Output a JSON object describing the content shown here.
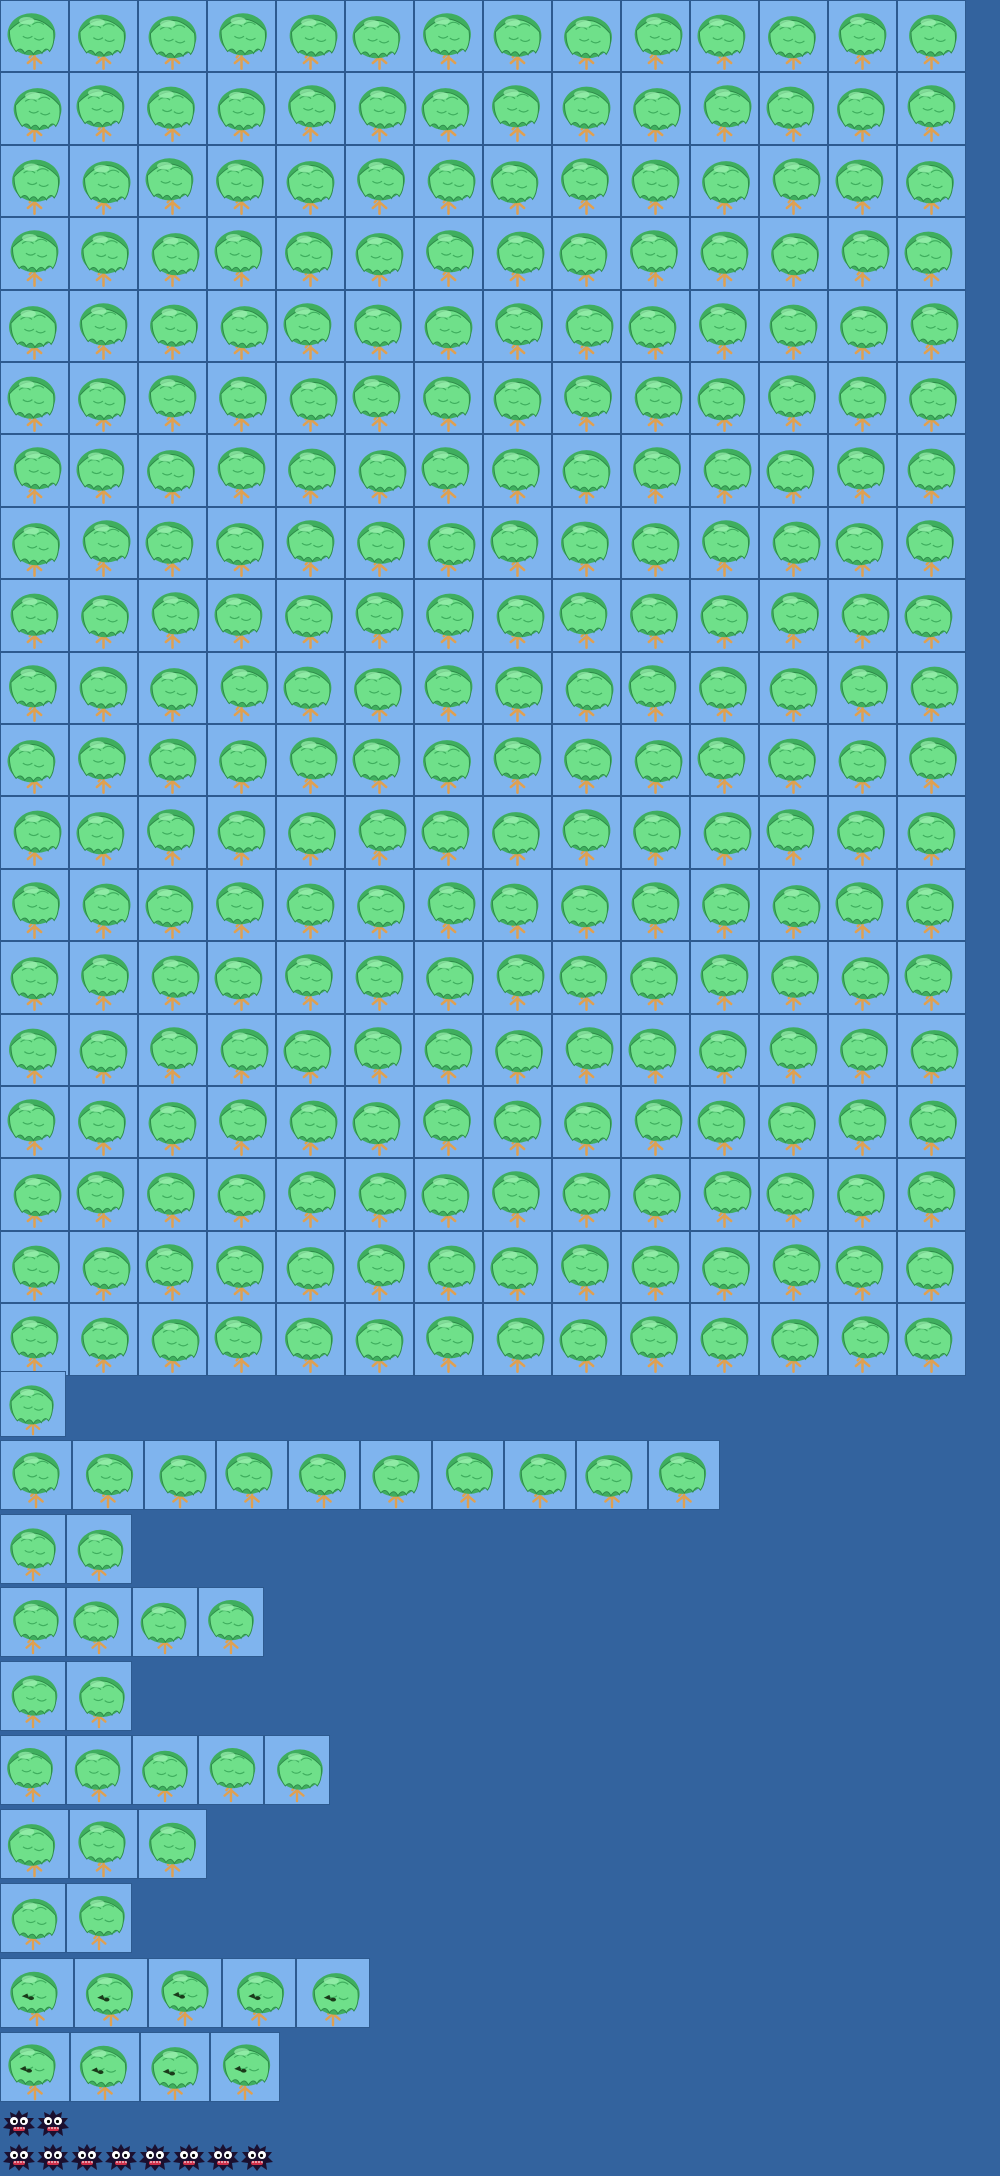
{
  "sheet": {
    "background_color": "#33639e",
    "cell_color": "#7fb4ee",
    "grid_line_color": "#2d5a8f"
  },
  "sprite_types": {
    "tree": {
      "icon": "tree-icon",
      "foliage_color": "#6fe08a",
      "foliage_shadow": "#3fae5e",
      "trunk_color": "#e0a050"
    },
    "tree_with_face": {
      "icon": "tree-face-icon",
      "eye_color": "#1a3a1a"
    },
    "monster": {
      "icon": "spiky-monster-icon",
      "body_color": "#1b1030",
      "eye_color": "#ffffff",
      "mouth_color": "#d0304a"
    }
  },
  "sprite_groups": [
    {
      "name": "tree-grid-main",
      "sprite": "tree",
      "rows": 19,
      "columns": 14
    },
    {
      "name": "tree-strip-1",
      "sprite": "tree",
      "rows": 1,
      "columns": 1
    },
    {
      "name": "tree-strip-2",
      "sprite": "tree",
      "rows": 1,
      "columns": 10
    },
    {
      "name": "tree-strip-3",
      "sprite": "tree",
      "rows": 1,
      "columns": 2
    },
    {
      "name": "tree-strip-4",
      "sprite": "tree",
      "rows": 1,
      "columns": 4
    },
    {
      "name": "tree-strip-5",
      "sprite": "tree",
      "rows": 1,
      "columns": 2
    },
    {
      "name": "tree-strip-6",
      "sprite": "tree",
      "rows": 1,
      "columns": 5
    },
    {
      "name": "tree-strip-7",
      "sprite": "tree",
      "rows": 1,
      "columns": 3
    },
    {
      "name": "tree-strip-8",
      "sprite": "tree",
      "rows": 1,
      "columns": 2
    },
    {
      "name": "tree-face-strip-1",
      "sprite": "tree_with_face",
      "rows": 1,
      "columns": 5
    },
    {
      "name": "tree-face-strip-2",
      "sprite": "tree_with_face",
      "rows": 1,
      "columns": 4
    },
    {
      "name": "monster-strip-1",
      "sprite": "monster",
      "rows": 1,
      "columns": 2
    },
    {
      "name": "monster-strip-2",
      "sprite": "monster",
      "rows": 1,
      "columns": 8
    }
  ]
}
